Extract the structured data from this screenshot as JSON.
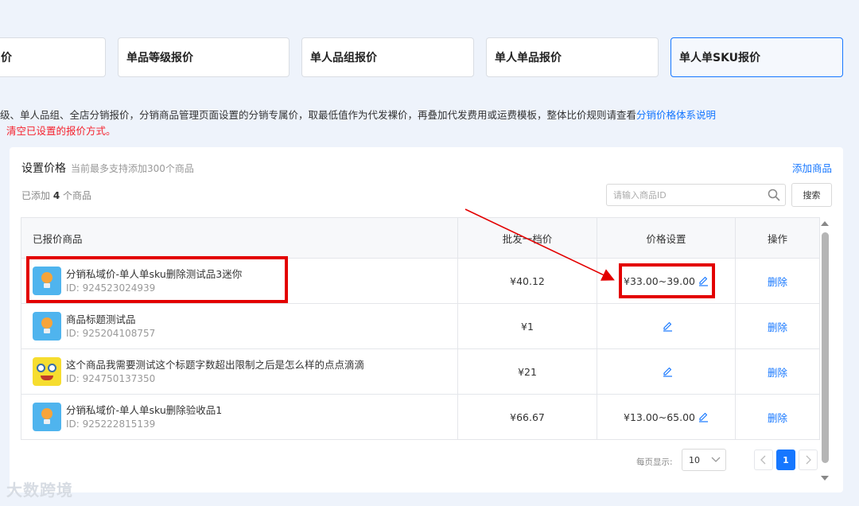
{
  "tabs": [
    {
      "label": "价"
    },
    {
      "label": "单品等级报价"
    },
    {
      "label": "单人品组报价"
    },
    {
      "label": "单人单品报价"
    },
    {
      "label": "单人单SKU报价"
    }
  ],
  "description": {
    "text": "级、单人品组、全店分销报价，分销商品管理页面设置的分销专属价，取最低值作为代发裸价，再叠加代发费用或运费模板，整体比价规则请查看",
    "link": "分销价格体系说明",
    "warning": "清空已设置的报价方式。"
  },
  "panel": {
    "title": "设置价格",
    "hint": "当前最多支持添加300个商品",
    "add_link": "添加商品",
    "added_prefix": "已添加",
    "added_count": "4",
    "added_suffix": "个商品",
    "search_placeholder": "请输入商品ID",
    "search_button": "搜索"
  },
  "table": {
    "headers": {
      "product": "已报价商品",
      "wholesale": "批发一档价",
      "price_setting": "价格设置",
      "action": "操作"
    },
    "rows": [
      {
        "name": "分销私域价-单人单sku删除测试品3迷你",
        "id": "ID: 924523024939",
        "wholesale": "¥40.12",
        "price": "¥33.00~39.00",
        "action": "删除",
        "thumb": "bulb"
      },
      {
        "name": "商品标题测试品",
        "id": "ID: 925204108757",
        "wholesale": "¥1",
        "price": "",
        "action": "删除",
        "thumb": "bulb"
      },
      {
        "name": "这个商品我需要测试这个标题字数超出限制之后是怎么样的点点滴滴",
        "id": "ID: 924750137350",
        "wholesale": "¥21",
        "price": "",
        "action": "删除",
        "thumb": "sponge"
      },
      {
        "name": "分销私域价-单人单sku删除验收品1",
        "id": "ID: 925222815139",
        "wholesale": "¥66.67",
        "price": "¥13.00~65.00",
        "action": "删除",
        "thumb": "bulb"
      }
    ]
  },
  "pagination": {
    "per_page_label": "每页显示:",
    "per_page_value": "10",
    "current_page": "1"
  },
  "icons": [
    "search-icon",
    "edit-pencil-icon",
    "chevron-down-icon",
    "chevron-left-icon",
    "chevron-right-icon"
  ],
  "colors": {
    "accent": "#1677ff",
    "highlight": "#e30000",
    "warning": "#f5222d"
  },
  "watermark": "大数跨境"
}
